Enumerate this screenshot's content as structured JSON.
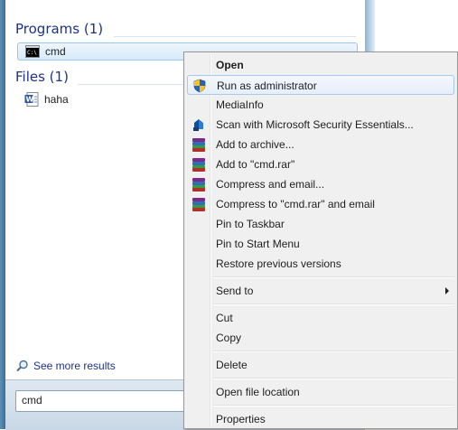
{
  "start_menu": {
    "programs_header": "Programs (1)",
    "program_items": [
      {
        "label": "cmd",
        "icon": "cmd-icon"
      }
    ],
    "files_header": "Files (1)",
    "file_items": [
      {
        "label": "haha",
        "icon": "word-document-icon"
      }
    ],
    "see_more": "See more results",
    "search_value": "cmd"
  },
  "context_menu": {
    "items": [
      {
        "label": "Open",
        "bold": true
      },
      {
        "label": "Run as administrator",
        "icon": "uac-shield-icon"
      },
      {
        "label": "MediaInfo"
      },
      {
        "label": "Scan with Microsoft Security Essentials...",
        "icon": "security-essentials-icon"
      },
      {
        "label": "Add to archive...",
        "icon": "winrar-icon"
      },
      {
        "label": "Add to \"cmd.rar\"",
        "icon": "winrar-icon"
      },
      {
        "label": "Compress and email...",
        "icon": "winrar-icon"
      },
      {
        "label": "Compress to \"cmd.rar\" and email",
        "icon": "winrar-icon"
      },
      {
        "label": "Pin to Taskbar"
      },
      {
        "label": "Pin to Start Menu"
      },
      {
        "label": "Restore previous versions"
      },
      {
        "label": "Send to",
        "submenu": true
      },
      {
        "label": "Cut"
      },
      {
        "label": "Copy"
      },
      {
        "label": "Delete"
      },
      {
        "label": "Open file location"
      },
      {
        "label": "Properties"
      }
    ]
  },
  "colors": {
    "header_text": "#1e3287",
    "hover_border": "#a8c8ec",
    "selected_bg": "#d7eaf9"
  }
}
